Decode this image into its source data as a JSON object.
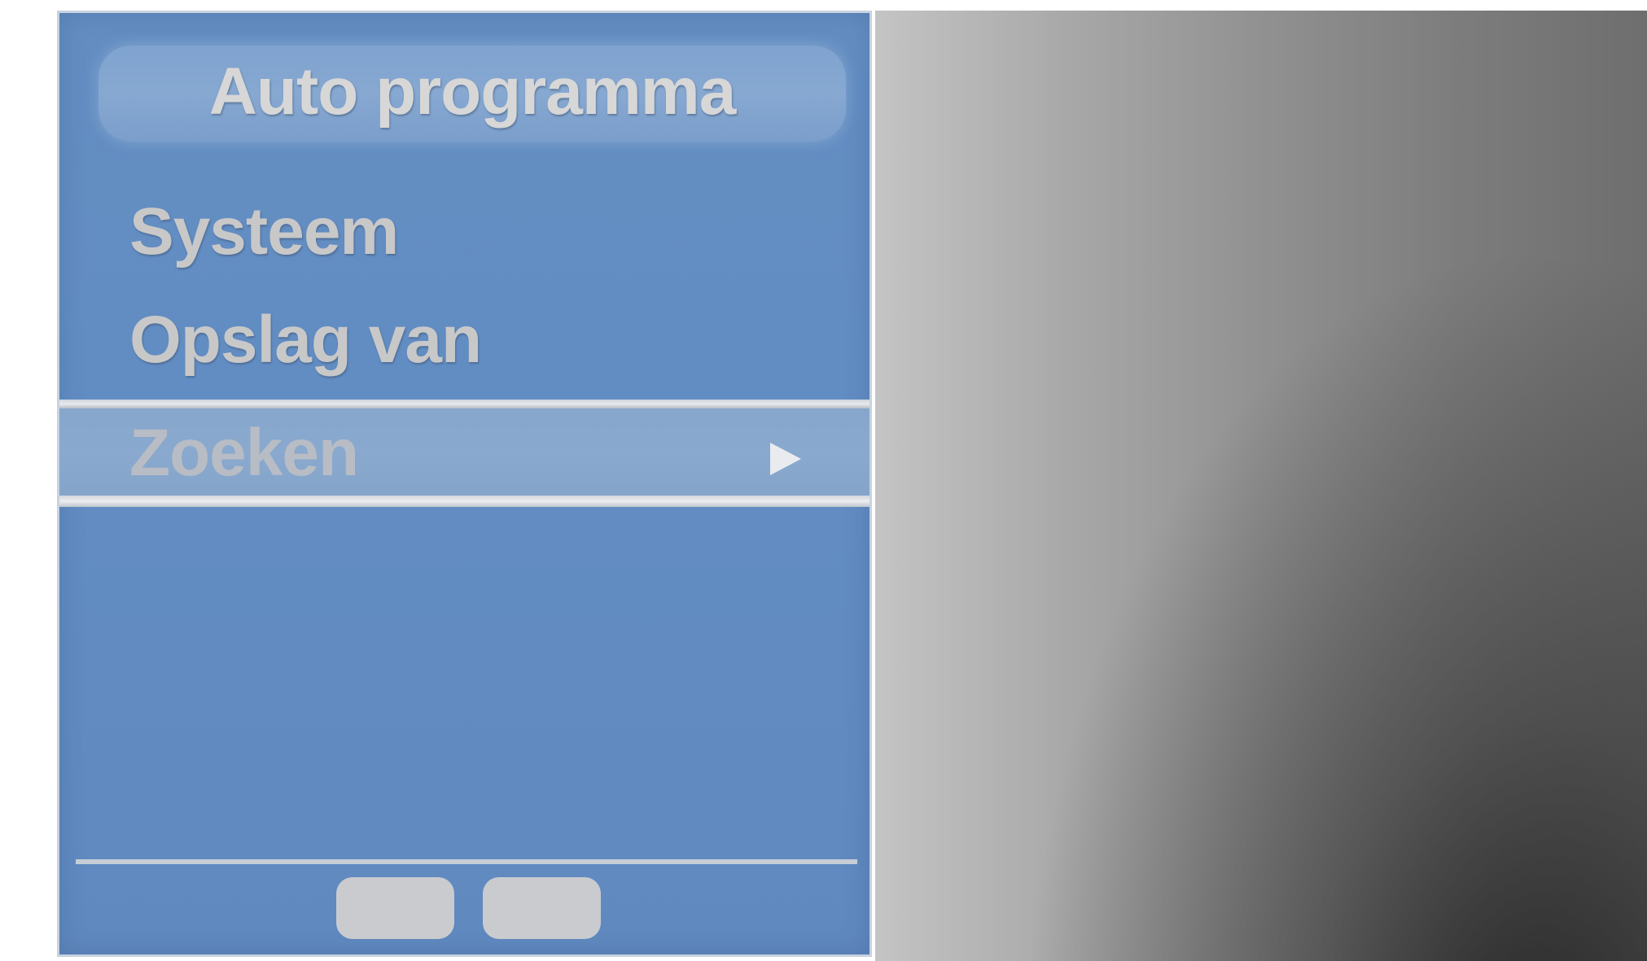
{
  "menu": {
    "title": "Auto programma",
    "items": [
      {
        "label": "Systeem"
      },
      {
        "label": "Opslag van"
      }
    ],
    "selected_item": {
      "label": "Zoeken",
      "icon": "triangle-right-icon"
    }
  },
  "footer": {
    "buttons": [
      {
        "label": ""
      },
      {
        "label": ""
      }
    ]
  },
  "colors": {
    "panel": "#628dc3",
    "highlight": "#8aa9ce",
    "text": "#c8c8c8"
  }
}
